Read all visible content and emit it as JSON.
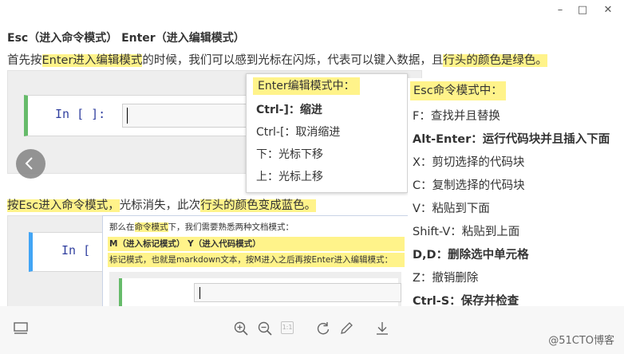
{
  "window": {
    "minimize_label": "–",
    "maximize_label": "□",
    "close_label": "✕"
  },
  "article": {
    "heading": "Esc（进入命令模式） Enter（进入编辑模式）",
    "para1": {
      "prefix": "首先按",
      "highlight1": "Enter进入编辑模式",
      "middle": "的时候，我们可以感到光标在闪烁，代表可以键入数据，且",
      "highlight2": "行头的颜色是绿色。"
    },
    "para2": {
      "highlight1": "按Esc进入命令模式，",
      "middle": "光标消失，此次",
      "highlight2": "行头的颜色变成蓝色。"
    }
  },
  "cells": {
    "green_prompt": "In [ ]:",
    "blue_prompt": "In ["
  },
  "nested_shot": {
    "line1_prefix": "那么在",
    "line1_highlight": "命令模式",
    "line1_suffix": "下，我们需要熟悉两种文档模式：",
    "line2": "M（进入标记模式） Y（进入代码模式）",
    "line3": "标记模式，也就是markdown文本，按M进入之后再按Enter进入编辑模式："
  },
  "edit_popup": {
    "title": "Enter编辑模式中：",
    "rows": [
      "Ctrl-]：缩进",
      "Ctrl-[：取消缩进",
      "下：光标下移",
      "上：光标上移"
    ]
  },
  "command_list": {
    "title": "Esc命令模式中：",
    "rows": [
      "F：查找并且替换",
      "Alt-Enter：运行代码块并且插入下面",
      "X：剪切选择的代码块",
      "C：复制选择的代码块",
      "V：粘贴到下面",
      "Shift-V：粘贴到上面",
      "D,D：删除选中单元格",
      "Z：撤销删除",
      "Ctrl-S：保存并检查"
    ],
    "bold_rows": [
      1,
      6,
      8
    ]
  },
  "toolbar": {
    "zoom_level": "1:1",
    "watermark": "@51CTO博客"
  },
  "colors": {
    "highlight": "#fff38a",
    "edit_mode_bar": "#66bb6a",
    "command_mode_bar": "#42a5f5",
    "prompt": "#303f9f",
    "toolbar_bg": "#f7f7f7"
  }
}
